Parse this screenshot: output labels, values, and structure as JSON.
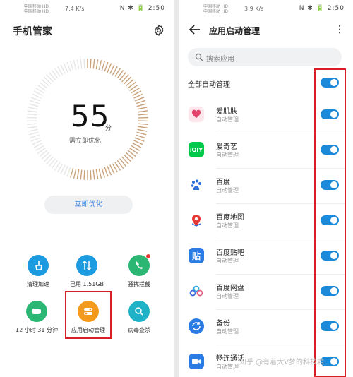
{
  "left": {
    "status": {
      "carrier1": "中国移动 HD",
      "carrier2": "中国移动 HD",
      "net": "7.4 K/s",
      "icons": "N ✱ 🔋",
      "time": "2:50"
    },
    "title": "手机管家",
    "score": "55",
    "score_unit": "分",
    "score_sub": "需立即优化",
    "optimize_label": "立即优化",
    "tools": [
      {
        "label": "清理加速"
      },
      {
        "label": "已用 1.51GB"
      },
      {
        "label": "骚扰拦截"
      },
      {
        "label": "12 小时 31 分钟"
      },
      {
        "label": "应用启动管理"
      },
      {
        "label": "病毒查杀"
      }
    ]
  },
  "right": {
    "status": {
      "carrier1": "中国移动 HD",
      "carrier2": "中国移动 HD",
      "net": "3.9 K/s",
      "icons": "N ✱ 🔋",
      "time": "2:50"
    },
    "title": "应用启动管理",
    "search_placeholder": "搜索应用",
    "all_label": "全部自动管理",
    "apps": [
      {
        "name": "爱肌肤",
        "status": "自动管理",
        "icon": "heart-icon",
        "enabled": true
      },
      {
        "name": "爱奇艺",
        "status": "自动管理",
        "icon": "iqiyi-icon",
        "enabled": true
      },
      {
        "name": "百度",
        "status": "自动管理",
        "icon": "baidu-paw-icon",
        "enabled": true
      },
      {
        "name": "百度地图",
        "status": "自动管理",
        "icon": "map-pin-icon",
        "enabled": true
      },
      {
        "name": "百度贴吧",
        "status": "自动管理",
        "icon": "tieba-icon",
        "enabled": true
      },
      {
        "name": "百度网盘",
        "status": "自动管理",
        "icon": "cloud-drive-icon",
        "enabled": true
      },
      {
        "name": "备份",
        "status": "自动管理",
        "icon": "backup-icon",
        "enabled": true
      },
      {
        "name": "畅连通话",
        "status": "自动管理",
        "icon": "video-call-icon",
        "enabled": true
      }
    ],
    "watermark": "知乎 @有着大V梦的科技君"
  },
  "colors": {
    "accent": "#1c8ad8",
    "highlight": "#d81e26",
    "gauge_tick": "#c9a27a"
  }
}
